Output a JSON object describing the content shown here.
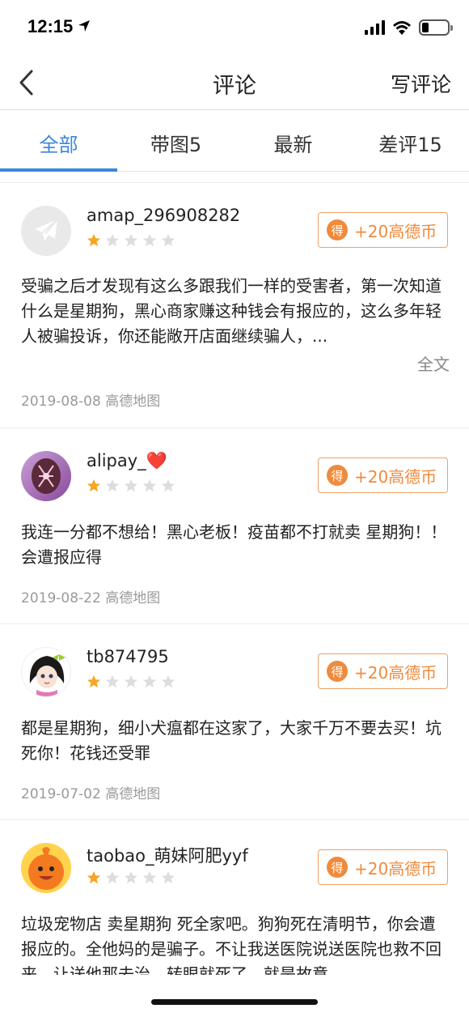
{
  "status_bar": {
    "time": "12:15"
  },
  "nav": {
    "title": "评论",
    "write_label": "写评论"
  },
  "tabs": [
    {
      "label": "全部",
      "active": true
    },
    {
      "label": "带图5",
      "active": false
    },
    {
      "label": "最新",
      "active": false
    },
    {
      "label": "差评15",
      "active": false
    }
  ],
  "colors": {
    "accent": "#3a86e0",
    "coin": "#f08a3c",
    "star_on": "#f5a623",
    "star_off": "#dddddd"
  },
  "reviews": [
    {
      "username": "amap_296908282",
      "rating": 1,
      "coin_label": "+20高德币",
      "coin_icon": "得",
      "text": "受骗之后才发现有这么多跟我们一样的受害者，第一次知道什么是星期狗，黑心商家赚这种钱会有报应的，这么多年轻人被骗投诉，你还能敞开店面继续骗人，...",
      "full_label": "全文",
      "date": "2019-08-08 高德地图",
      "avatar": "paper-plane-icon"
    },
    {
      "username": "alipay_❤️",
      "rating": 1,
      "coin_label": "+20高德币",
      "coin_icon": "得",
      "text": "我连一分都不想给！黑心老板！疫苗都不打就卖 星期狗！！会遭报应得",
      "date": "2019-08-22 高德地图",
      "avatar": "braid-avatar"
    },
    {
      "username": "tb874795",
      "rating": 1,
      "coin_label": "+20高德币",
      "coin_icon": "得",
      "text": "都是星期狗，细小犬瘟都在这家了，大家千万不要去买！坑死你！花钱还受罪",
      "date": "2019-07-02 高德地图",
      "avatar": "cartoon-girl-avatar"
    },
    {
      "username": "taobao_萌妹阿肥yyf",
      "rating": 1,
      "coin_label": "+20高德币",
      "coin_icon": "得",
      "text": "垃圾宠物店  卖星期狗 死全家吧。狗狗死在清明节，你会遭报应的。全他妈的是骗子。不让我送医院说送医院也救不回来，让送他那去治，转眼就死了，就是故意",
      "avatar": "orange-mascot-avatar"
    }
  ]
}
